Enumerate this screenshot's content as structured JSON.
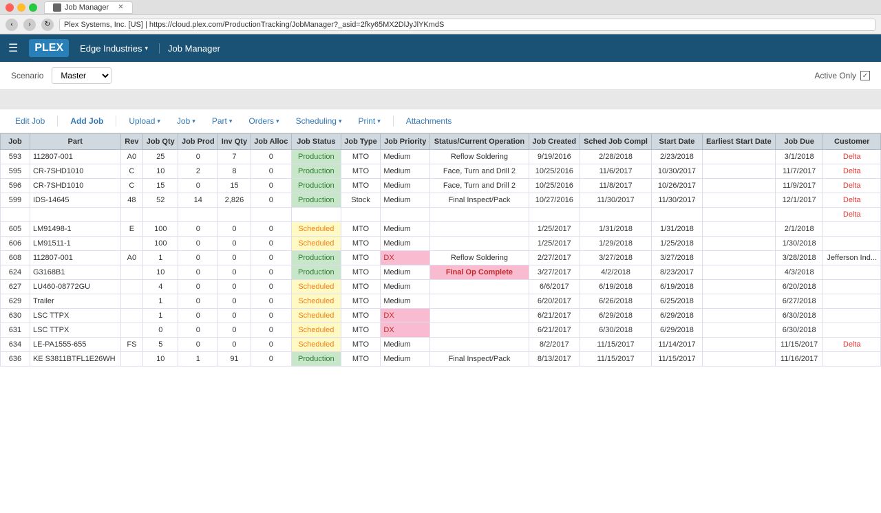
{
  "titlebar": {
    "tab_label": "Job Manager",
    "close_dot": "close",
    "min_dot": "min",
    "max_dot": "max"
  },
  "urlbar": {
    "url": "Plex Systems, Inc. [US] | https://cloud.plex.com/ProductionTracking/JobManager?_asid=2fky65MX2DlJyJlYKmdS"
  },
  "header": {
    "app_name": "PLEX",
    "company": "Edge Industries",
    "module": "Job Manager"
  },
  "scenario": {
    "label": "Scenario",
    "value": "Master",
    "active_only_label": "Active Only"
  },
  "toolbar": {
    "edit_job": "Edit Job",
    "add_job": "Add Job",
    "upload": "Upload",
    "job": "Job",
    "part": "Part",
    "orders": "Orders",
    "scheduling": "Scheduling",
    "print": "Print",
    "attachments": "Attachments"
  },
  "table": {
    "headers": [
      "Job",
      "Part",
      "Rev",
      "Job Qty",
      "Job Prod",
      "Inv Qty",
      "Job Alloc",
      "Job Status",
      "Job Type",
      "Job Priority",
      "Status/Current Operation",
      "Job Created",
      "Sched Job Compl",
      "Start Date",
      "Earliest Start Date",
      "Job Due",
      "Customer"
    ],
    "rows": [
      {
        "job": "593",
        "part": "112807-001",
        "rev": "A0",
        "job_qty": "25",
        "job_prod": "0",
        "inv_qty": "7",
        "job_alloc": "0",
        "status": "Production",
        "type": "MTO",
        "priority": "Medium",
        "operation": "Reflow Soldering",
        "created": "9/19/2016",
        "compl": "2/28/2018",
        "start": "2/23/2018",
        "earliest": "",
        "due": "3/1/2018",
        "customer": "Delta",
        "status_class": "status-production",
        "priority_class": "",
        "op_class": "",
        "customer_class": "customer-delta"
      },
      {
        "job": "595",
        "part": "CR-7SHD1010",
        "rev": "C",
        "job_qty": "10",
        "job_prod": "2",
        "inv_qty": "8",
        "job_alloc": "0",
        "status": "Production",
        "type": "MTO",
        "priority": "Medium",
        "operation": "Face, Turn and Drill 2",
        "created": "10/25/2016",
        "compl": "11/6/2017",
        "start": "10/30/2017",
        "earliest": "",
        "due": "11/7/2017",
        "customer": "Delta",
        "status_class": "status-production",
        "priority_class": "",
        "op_class": "",
        "customer_class": "customer-delta"
      },
      {
        "job": "596",
        "part": "CR-7SHD1010",
        "rev": "C",
        "job_qty": "15",
        "job_prod": "0",
        "inv_qty": "15",
        "job_alloc": "0",
        "status": "Production",
        "type": "MTO",
        "priority": "Medium",
        "operation": "Face, Turn and Drill 2",
        "created": "10/25/2016",
        "compl": "11/8/2017",
        "start": "10/26/2017",
        "earliest": "",
        "due": "11/9/2017",
        "customer": "Delta",
        "status_class": "status-production",
        "priority_class": "",
        "op_class": "",
        "customer_class": "customer-delta"
      },
      {
        "job": "599",
        "part": "IDS-14645",
        "rev": "48",
        "job_qty": "52",
        "job_prod": "14",
        "inv_qty": "2,826",
        "job_alloc": "0",
        "status": "Production",
        "type": "Stock",
        "priority": "Medium",
        "operation": "Final Inspect/Pack",
        "created": "10/27/2016",
        "compl": "11/30/2017",
        "start": "11/30/2017",
        "earliest": "",
        "due": "12/1/2017",
        "customer": "Delta",
        "status_class": "status-production",
        "priority_class": "",
        "op_class": "",
        "customer_class": "customer-delta"
      },
      {
        "job": "",
        "part": "",
        "rev": "",
        "job_qty": "",
        "job_prod": "",
        "inv_qty": "",
        "job_alloc": "",
        "status": "",
        "type": "",
        "priority": "",
        "operation": "",
        "created": "",
        "compl": "",
        "start": "",
        "earliest": "",
        "due": "",
        "customer": "Delta",
        "status_class": "",
        "priority_class": "",
        "op_class": "",
        "customer_class": "customer-delta"
      },
      {
        "job": "605",
        "part": "LM91498-1",
        "rev": "E",
        "job_qty": "100",
        "job_prod": "0",
        "inv_qty": "0",
        "job_alloc": "0",
        "status": "Scheduled",
        "type": "MTO",
        "priority": "Medium",
        "operation": "",
        "created": "1/25/2017",
        "compl": "1/31/2018",
        "start": "1/31/2018",
        "earliest": "",
        "due": "2/1/2018",
        "customer": "",
        "status_class": "status-scheduled",
        "priority_class": "",
        "op_class": "",
        "customer_class": ""
      },
      {
        "job": "606",
        "part": "LM91511-1",
        "rev": "",
        "job_qty": "100",
        "job_prod": "0",
        "inv_qty": "0",
        "job_alloc": "0",
        "status": "Scheduled",
        "type": "MTO",
        "priority": "Medium",
        "operation": "",
        "created": "1/25/2017",
        "compl": "1/29/2018",
        "start": "1/25/2018",
        "earliest": "",
        "due": "1/30/2018",
        "customer": "",
        "status_class": "status-scheduled",
        "priority_class": "",
        "op_class": "",
        "customer_class": ""
      },
      {
        "job": "608",
        "part": "112807-001",
        "rev": "A0",
        "job_qty": "1",
        "job_prod": "0",
        "inv_qty": "0",
        "job_alloc": "0",
        "status": "Production",
        "type": "MTO",
        "priority": "DX",
        "operation": "Reflow Soldering",
        "created": "2/27/2017",
        "compl": "3/27/2018",
        "start": "3/27/2018",
        "earliest": "",
        "due": "3/28/2018",
        "customer": "Jefferson Ind...",
        "status_class": "status-production",
        "priority_class": "priority-dx",
        "op_class": "",
        "customer_class": ""
      },
      {
        "job": "624",
        "part": "G3168B1",
        "rev": "",
        "job_qty": "10",
        "job_prod": "0",
        "inv_qty": "0",
        "job_alloc": "0",
        "status": "Production",
        "type": "MTO",
        "priority": "Medium",
        "operation": "Final Op Complete",
        "created": "3/27/2017",
        "compl": "4/2/2018",
        "start": "8/23/2017",
        "earliest": "",
        "due": "4/3/2018",
        "customer": "",
        "status_class": "status-production",
        "priority_class": "",
        "op_class": "op-complete",
        "customer_class": ""
      },
      {
        "job": "627",
        "part": "LU460-08772GU",
        "rev": "",
        "job_qty": "4",
        "job_prod": "0",
        "inv_qty": "0",
        "job_alloc": "0",
        "status": "Scheduled",
        "type": "MTO",
        "priority": "Medium",
        "operation": "",
        "created": "6/6/2017",
        "compl": "6/19/2018",
        "start": "6/19/2018",
        "earliest": "",
        "due": "6/20/2018",
        "customer": "",
        "status_class": "status-scheduled",
        "priority_class": "",
        "op_class": "",
        "customer_class": ""
      },
      {
        "job": "629",
        "part": "Trailer",
        "rev": "",
        "job_qty": "1",
        "job_prod": "0",
        "inv_qty": "0",
        "job_alloc": "0",
        "status": "Scheduled",
        "type": "MTO",
        "priority": "Medium",
        "operation": "",
        "created": "6/20/2017",
        "compl": "6/26/2018",
        "start": "6/25/2018",
        "earliest": "",
        "due": "6/27/2018",
        "customer": "",
        "status_class": "status-scheduled",
        "priority_class": "",
        "op_class": "",
        "customer_class": ""
      },
      {
        "job": "630",
        "part": "LSC TTPX",
        "rev": "",
        "job_qty": "1",
        "job_prod": "0",
        "inv_qty": "0",
        "job_alloc": "0",
        "status": "Scheduled",
        "type": "MTO",
        "priority": "DX",
        "operation": "",
        "created": "6/21/2017",
        "compl": "6/29/2018",
        "start": "6/29/2018",
        "earliest": "",
        "due": "6/30/2018",
        "customer": "",
        "status_class": "status-scheduled",
        "priority_class": "priority-dx",
        "op_class": "",
        "customer_class": ""
      },
      {
        "job": "631",
        "part": "LSC TTPX",
        "rev": "",
        "job_qty": "0",
        "job_prod": "0",
        "inv_qty": "0",
        "job_alloc": "0",
        "status": "Scheduled",
        "type": "MTO",
        "priority": "DX",
        "operation": "",
        "created": "6/21/2017",
        "compl": "6/30/2018",
        "start": "6/29/2018",
        "earliest": "",
        "due": "6/30/2018",
        "customer": "",
        "status_class": "status-scheduled",
        "priority_class": "priority-dx",
        "op_class": "",
        "customer_class": ""
      },
      {
        "job": "634",
        "part": "LE-PA1555-655",
        "rev": "FS",
        "job_qty": "5",
        "job_prod": "0",
        "inv_qty": "0",
        "job_alloc": "0",
        "status": "Scheduled",
        "type": "MTO",
        "priority": "Medium",
        "operation": "",
        "created": "8/2/2017",
        "compl": "11/15/2017",
        "start": "11/14/2017",
        "earliest": "",
        "due": "11/15/2017",
        "customer": "Delta",
        "status_class": "status-scheduled",
        "priority_class": "",
        "op_class": "",
        "customer_class": "customer-delta"
      },
      {
        "job": "636",
        "part": "KE S3811BTFL1E26WH",
        "rev": "",
        "job_qty": "10",
        "job_prod": "1",
        "inv_qty": "91",
        "job_alloc": "0",
        "status": "Production",
        "type": "MTO",
        "priority": "Medium",
        "operation": "Final Inspect/Pack",
        "created": "8/13/2017",
        "compl": "11/15/2017",
        "start": "11/15/2017",
        "earliest": "",
        "due": "11/16/2017",
        "customer": "",
        "status_class": "status-production",
        "priority_class": "",
        "op_class": "",
        "customer_class": ""
      }
    ]
  }
}
